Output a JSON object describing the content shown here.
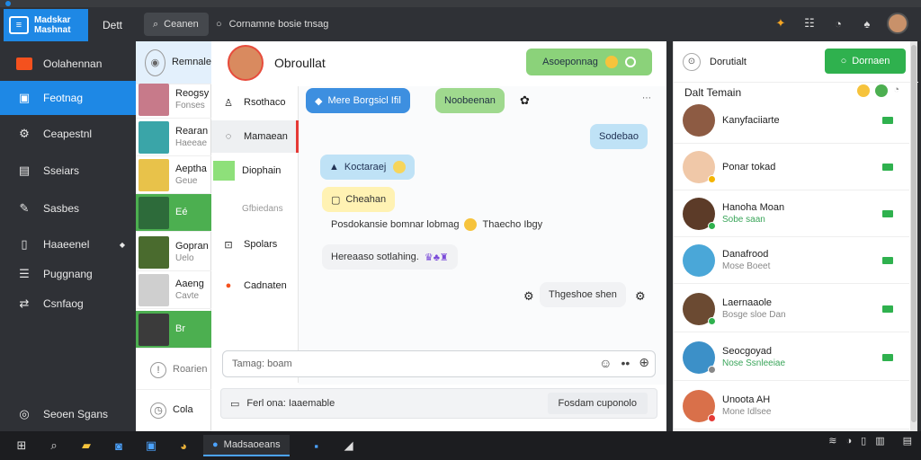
{
  "colors": {
    "accent": "#1e88e5",
    "green": "#2fb14e",
    "sidebar_bg": "#2f3136"
  },
  "topbar": {
    "logo_line1": "Madskar",
    "logo_line2": "Mashnat",
    "dett": "Dett",
    "search1": "Ceanen",
    "search2": "Cornamne bosie tnsag",
    "icons": [
      "bell-icon",
      "grid-icon",
      "clock-icon",
      "flame-icon",
      "profile-avatar"
    ]
  },
  "sidebar": {
    "items": [
      {
        "label": "Oolahennan",
        "icon": "orange-square-icon"
      },
      {
        "label": "Feotnag",
        "icon": "chat-icon"
      },
      {
        "label": "Ceapestnl",
        "icon": "gear-icon"
      },
      {
        "label": "Sseiars",
        "icon": "files-icon"
      },
      {
        "label": "Sasbes",
        "icon": "pen-icon"
      },
      {
        "label": "Haaeenel",
        "icon": "book-icon"
      },
      {
        "label": "Puggnang",
        "icon": "list-icon"
      },
      {
        "label": "Csnfaog",
        "icon": "settings-icon"
      }
    ],
    "bottom": "Seoen Sgans"
  },
  "contacts": [
    {
      "name": "Remnale",
      "sub": ""
    },
    {
      "name": "Reogsy",
      "sub": "Fonses"
    },
    {
      "name": "Rearan",
      "sub": "Haeeae"
    },
    {
      "name": "Aeptha",
      "sub": "Geue"
    },
    {
      "name": "Eé",
      "sub": ""
    },
    {
      "name": "Gopran",
      "sub": "Uelo"
    },
    {
      "name": "Aaeng",
      "sub": "Cavte"
    },
    {
      "name": "Br",
      "sub": ""
    },
    {
      "name": "Roarien",
      "sub": ""
    },
    {
      "name": "Cola",
      "sub": ""
    }
  ],
  "chat": {
    "name": "Obroullat",
    "header_pill": "Asoeponnag",
    "subnav": [
      "Rsothaco",
      "Mamaean",
      "Diophain",
      "Gfbiedans",
      "Spolars",
      "Cadnaten"
    ],
    "messages": [
      "Mere Borgsicl Ifil",
      "Noobeenan",
      "Sodebao",
      "Koctaraej",
      "Cheahan",
      "Posdokansie bomnar lobmag",
      "Thaecho Ibgy",
      "Hereaaso sotlahing.",
      "Thgeshoe shen"
    ],
    "composer_placeholder": "Tamag: boam",
    "footer_left": "Ferl ona: Iaaemable",
    "footer_right": "Fosdam cuponolo"
  },
  "right_panel": {
    "top_label": "Dorutialt",
    "top_button": "Dornaen",
    "title": "Dalt Temain",
    "rows": [
      {
        "name": "Kanyfaciiarte",
        "sub": "",
        "badge_color": ""
      },
      {
        "name": "Ponar tokad",
        "sub": "",
        "badge_color": "#f4b400"
      },
      {
        "name": "Hanoha Moan",
        "sub": "Sobe saan",
        "badge_color": "#2fb14e"
      },
      {
        "name": "Danafrood",
        "sub": "Mose Boeet",
        "badge_color": ""
      },
      {
        "name": "Laernaaole",
        "sub": "Bosge sloe Dan",
        "badge_color": "#2fb14e"
      },
      {
        "name": "Seocgoyad",
        "sub": "Nose Ssnleeiae",
        "badge_color": "#888888"
      },
      {
        "name": "Unoota AH",
        "sub": "Mone Idlsee",
        "badge_color": "#e53935"
      }
    ]
  },
  "taskbar": {
    "app_label": "Madsaoeans",
    "clock_line1": "",
    "clock_line2": ""
  }
}
